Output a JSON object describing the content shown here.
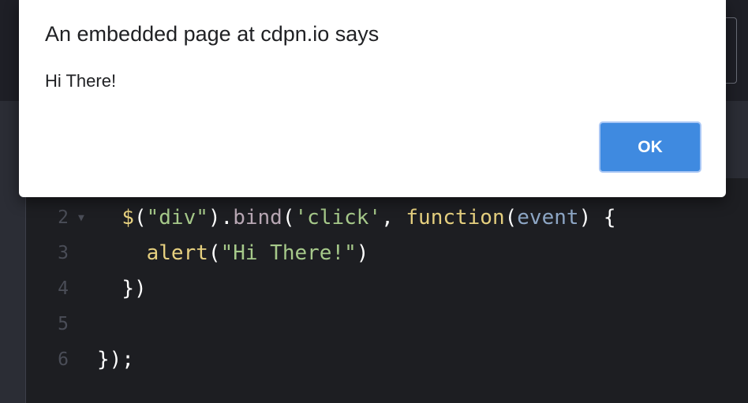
{
  "dialog": {
    "title": "An embedded page at cdpn.io says",
    "message": "Hi There!",
    "ok_label": "OK"
  },
  "editor": {
    "lines": [
      {
        "number": "2",
        "has_fold": true,
        "tokens": [
          {
            "text": "  ",
            "kind": "punc"
          },
          {
            "text": "$",
            "kind": "fn"
          },
          {
            "text": "(",
            "kind": "punc"
          },
          {
            "text": "\"div\"",
            "kind": "str"
          },
          {
            "text": ").",
            "kind": "punc"
          },
          {
            "text": "bind",
            "kind": "meth"
          },
          {
            "text": "(",
            "kind": "punc"
          },
          {
            "text": "'click'",
            "kind": "str"
          },
          {
            "text": ", ",
            "kind": "punc"
          },
          {
            "text": "function",
            "kind": "kw"
          },
          {
            "text": "(",
            "kind": "punc"
          },
          {
            "text": "event",
            "kind": "arg"
          },
          {
            "text": ") {",
            "kind": "punc"
          }
        ]
      },
      {
        "number": "3",
        "has_fold": false,
        "tokens": [
          {
            "text": "    ",
            "kind": "punc"
          },
          {
            "text": "alert",
            "kind": "fn"
          },
          {
            "text": "(",
            "kind": "punc"
          },
          {
            "text": "\"Hi There!\"",
            "kind": "str"
          },
          {
            "text": ")",
            "kind": "punc"
          }
        ]
      },
      {
        "number": "4",
        "has_fold": false,
        "tokens": [
          {
            "text": "  ",
            "kind": "punc"
          },
          {
            "text": "})",
            "kind": "punc"
          }
        ]
      },
      {
        "number": "5",
        "has_fold": false,
        "tokens": []
      },
      {
        "number": "6",
        "has_fold": false,
        "tokens": [
          {
            "text": "});",
            "kind": "punc"
          }
        ]
      }
    ],
    "fold_icon": "▼"
  },
  "colors": {
    "accent": "#3f8ae0",
    "editor_bg": "#1d1e22"
  }
}
